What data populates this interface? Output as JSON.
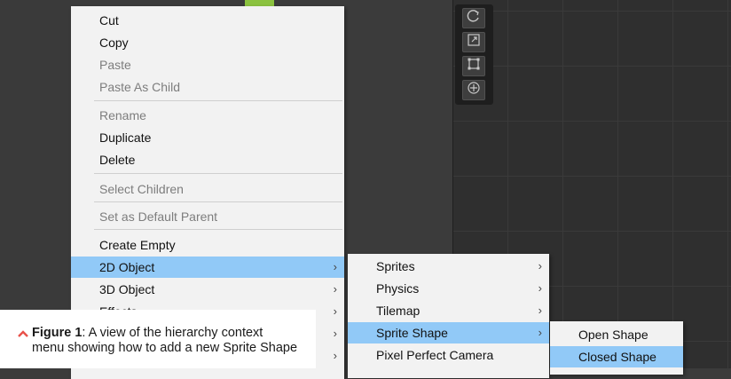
{
  "context_menu": {
    "items": [
      {
        "label": "Cut",
        "disabled": false
      },
      {
        "label": "Copy",
        "disabled": false
      },
      {
        "label": "Paste",
        "disabled": true
      },
      {
        "label": "Paste As Child",
        "disabled": true
      },
      {
        "label": "Rename",
        "disabled": true
      },
      {
        "label": "Duplicate",
        "disabled": false
      },
      {
        "label": "Delete",
        "disabled": false
      },
      {
        "label": "Select Children",
        "disabled": true
      },
      {
        "label": "Set as Default Parent",
        "disabled": true
      },
      {
        "label": "Create Empty",
        "disabled": false
      },
      {
        "label": "2D Object",
        "disabled": false,
        "highlighted": true,
        "has_submenu": true
      },
      {
        "label": "3D Object",
        "disabled": false,
        "has_submenu": true
      },
      {
        "label": "Effects",
        "disabled": false,
        "has_submenu": true
      }
    ]
  },
  "submenu_2d": {
    "items": [
      {
        "label": "Sprites",
        "has_submenu": true
      },
      {
        "label": "Physics",
        "has_submenu": true
      },
      {
        "label": "Tilemap",
        "has_submenu": true
      },
      {
        "label": "Sprite Shape",
        "has_submenu": true,
        "highlighted": true
      },
      {
        "label": "Pixel Perfect Camera",
        "has_submenu": false
      }
    ]
  },
  "submenu_sprite_shape": {
    "items": [
      {
        "label": "Open Shape"
      },
      {
        "label": "Closed Shape",
        "highlighted": true
      }
    ]
  },
  "scene_tools": [
    "rotate-tool-icon",
    "scale-tool-icon",
    "rect-tool-icon",
    "transform-tool-icon"
  ],
  "caption": {
    "figure_label": "Figure 1",
    "text": ": A view of the hierarchy context menu showing how to add a new Sprite Shape"
  },
  "colors": {
    "menu_bg": "#f2f2f2",
    "highlight": "#91c9f7",
    "accent_green": "#8bc23f",
    "caption_chevron": "#e8524a"
  }
}
